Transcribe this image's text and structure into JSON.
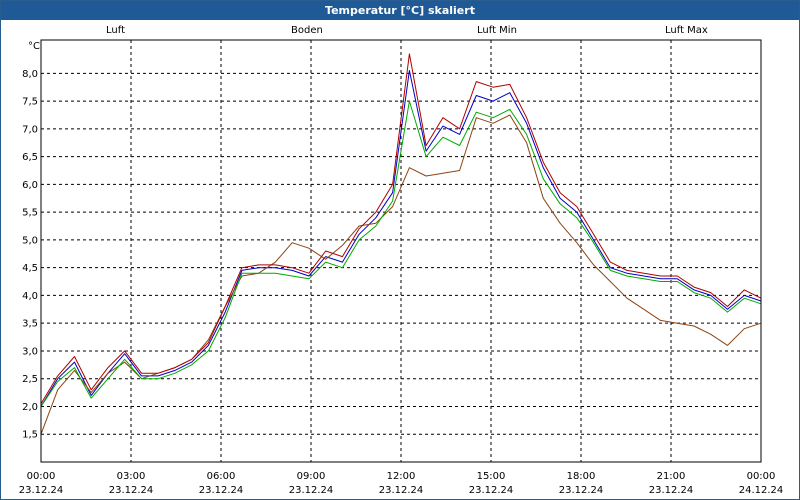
{
  "window": {
    "title": "Temperatur [°C] skaliert"
  },
  "chart_data": {
    "type": "line",
    "ylabel": "°C",
    "ylim": [
      1.5,
      8.5
    ],
    "xlim": [
      "23.12.24 00:00",
      "24.12.24 00:00"
    ],
    "yticks": [
      "8,0",
      "7,5",
      "7,0",
      "6,5",
      "6,0",
      "5,5",
      "5,0",
      "4,5",
      "4,0",
      "3,5",
      "3,0",
      "2,5",
      "2,0",
      "1,5"
    ],
    "xticks": [
      {
        "time": "00:00",
        "date": "23.12.24"
      },
      {
        "time": "03:00",
        "date": "23.12.24"
      },
      {
        "time": "06:00",
        "date": "23.12.24"
      },
      {
        "time": "09:00",
        "date": "23.12.24"
      },
      {
        "time": "12:00",
        "date": "23.12.24"
      },
      {
        "time": "15:00",
        "date": "23.12.24"
      },
      {
        "time": "18:00",
        "date": "23.12.24"
      },
      {
        "time": "21:00",
        "date": "23.12.24"
      },
      {
        "time": "00:00",
        "date": "24.12.24"
      }
    ],
    "grid": true,
    "legend_position": "top",
    "x": [
      "00:00",
      "00:30",
      "01:00",
      "01:30",
      "02:00",
      "02:30",
      "03:00",
      "03:30",
      "04:00",
      "04:30",
      "05:00",
      "05:30",
      "06:00",
      "06:30",
      "07:00",
      "07:30",
      "08:00",
      "08:30",
      "09:00",
      "09:30",
      "10:00",
      "10:30",
      "11:00",
      "11:30",
      "12:00",
      "12:30",
      "13:00",
      "13:30",
      "14:00",
      "14:30",
      "15:00",
      "15:30",
      "16:00",
      "16:30",
      "17:00",
      "17:30",
      "18:00",
      "18:30",
      "19:00",
      "19:30",
      "20:00",
      "20:30",
      "21:00",
      "21:30",
      "22:00",
      "22:30",
      "23:00",
      "23:30",
      "24:00"
    ],
    "series": [
      {
        "name": "Luft",
        "color": "#0000c8",
        "values": [
          2.0,
          2.5,
          2.8,
          2.2,
          2.6,
          2.95,
          2.55,
          2.55,
          2.65,
          2.8,
          3.1,
          3.7,
          4.45,
          4.5,
          4.5,
          4.45,
          4.35,
          4.7,
          4.6,
          5.1,
          5.4,
          5.85,
          8.05,
          6.6,
          7.05,
          6.9,
          7.6,
          7.5,
          7.65,
          7.1,
          6.3,
          5.75,
          5.5,
          5.0,
          4.5,
          4.4,
          4.35,
          4.3,
          4.3,
          4.1,
          4.0,
          3.75,
          4.0,
          3.9
        ]
      },
      {
        "name": "Boden",
        "color": "#8b4513",
        "values": [
          1.5,
          2.3,
          2.65,
          2.25,
          2.6,
          2.8,
          2.5,
          2.6,
          2.7,
          2.85,
          3.2,
          3.8,
          4.35,
          4.4,
          4.6,
          4.95,
          4.85,
          4.65,
          4.9,
          5.25,
          5.3,
          5.6,
          6.3,
          6.15,
          6.2,
          6.25,
          7.2,
          7.1,
          7.25,
          6.75,
          5.75,
          5.3,
          4.95,
          4.55,
          4.25,
          3.95,
          3.75,
          3.55,
          3.5,
          3.45,
          3.3,
          3.1,
          3.4,
          3.5
        ]
      },
      {
        "name": "Luft Min",
        "color": "#00aa00",
        "values": [
          2.0,
          2.45,
          2.7,
          2.15,
          2.5,
          2.85,
          2.5,
          2.5,
          2.6,
          2.75,
          3.0,
          3.6,
          4.4,
          4.4,
          4.4,
          4.35,
          4.3,
          4.6,
          4.5,
          5.0,
          5.25,
          5.7,
          7.5,
          6.5,
          6.85,
          6.7,
          7.3,
          7.2,
          7.35,
          6.9,
          6.1,
          5.65,
          5.4,
          4.95,
          4.45,
          4.35,
          4.3,
          4.25,
          4.25,
          4.05,
          3.95,
          3.7,
          3.95,
          3.85
        ]
      },
      {
        "name": "Luft Max",
        "color": "#b00000",
        "values": [
          2.05,
          2.55,
          2.9,
          2.3,
          2.7,
          3.0,
          2.6,
          2.6,
          2.7,
          2.85,
          3.15,
          3.8,
          4.5,
          4.55,
          4.55,
          4.5,
          4.4,
          4.8,
          4.7,
          5.2,
          5.5,
          6.0,
          8.35,
          6.7,
          7.2,
          7.0,
          7.85,
          7.75,
          7.8,
          7.2,
          6.4,
          5.85,
          5.6,
          5.1,
          4.6,
          4.45,
          4.4,
          4.35,
          4.35,
          4.15,
          4.05,
          3.8,
          4.1,
          3.95
        ]
      }
    ]
  }
}
